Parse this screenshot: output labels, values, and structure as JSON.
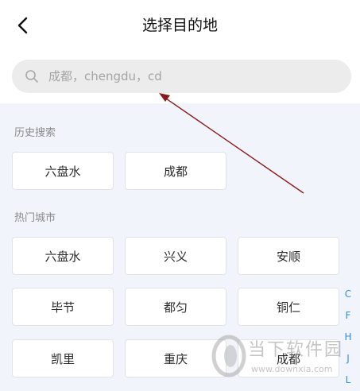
{
  "header": {
    "title": "选择目的地",
    "back_icon": "chevron-left-icon"
  },
  "search": {
    "placeholder": "成都，chengdu，cd",
    "icon": "search-icon"
  },
  "history": {
    "label": "历史搜索",
    "items": [
      "六盘水",
      "成都"
    ]
  },
  "hot": {
    "label": "热门城市",
    "items": [
      "六盘水",
      "兴义",
      "安顺",
      "毕节",
      "都匀",
      "铜仁",
      "凯里",
      "重庆",
      "成都"
    ]
  },
  "index_letters": [
    "C",
    "F",
    "H",
    "J",
    "L"
  ],
  "watermark": {
    "text": "当下软件园",
    "url": "www.downxia.com"
  },
  "colors": {
    "accent": "#2f8fe4",
    "annotation_arrow": "#8b1a1a"
  }
}
